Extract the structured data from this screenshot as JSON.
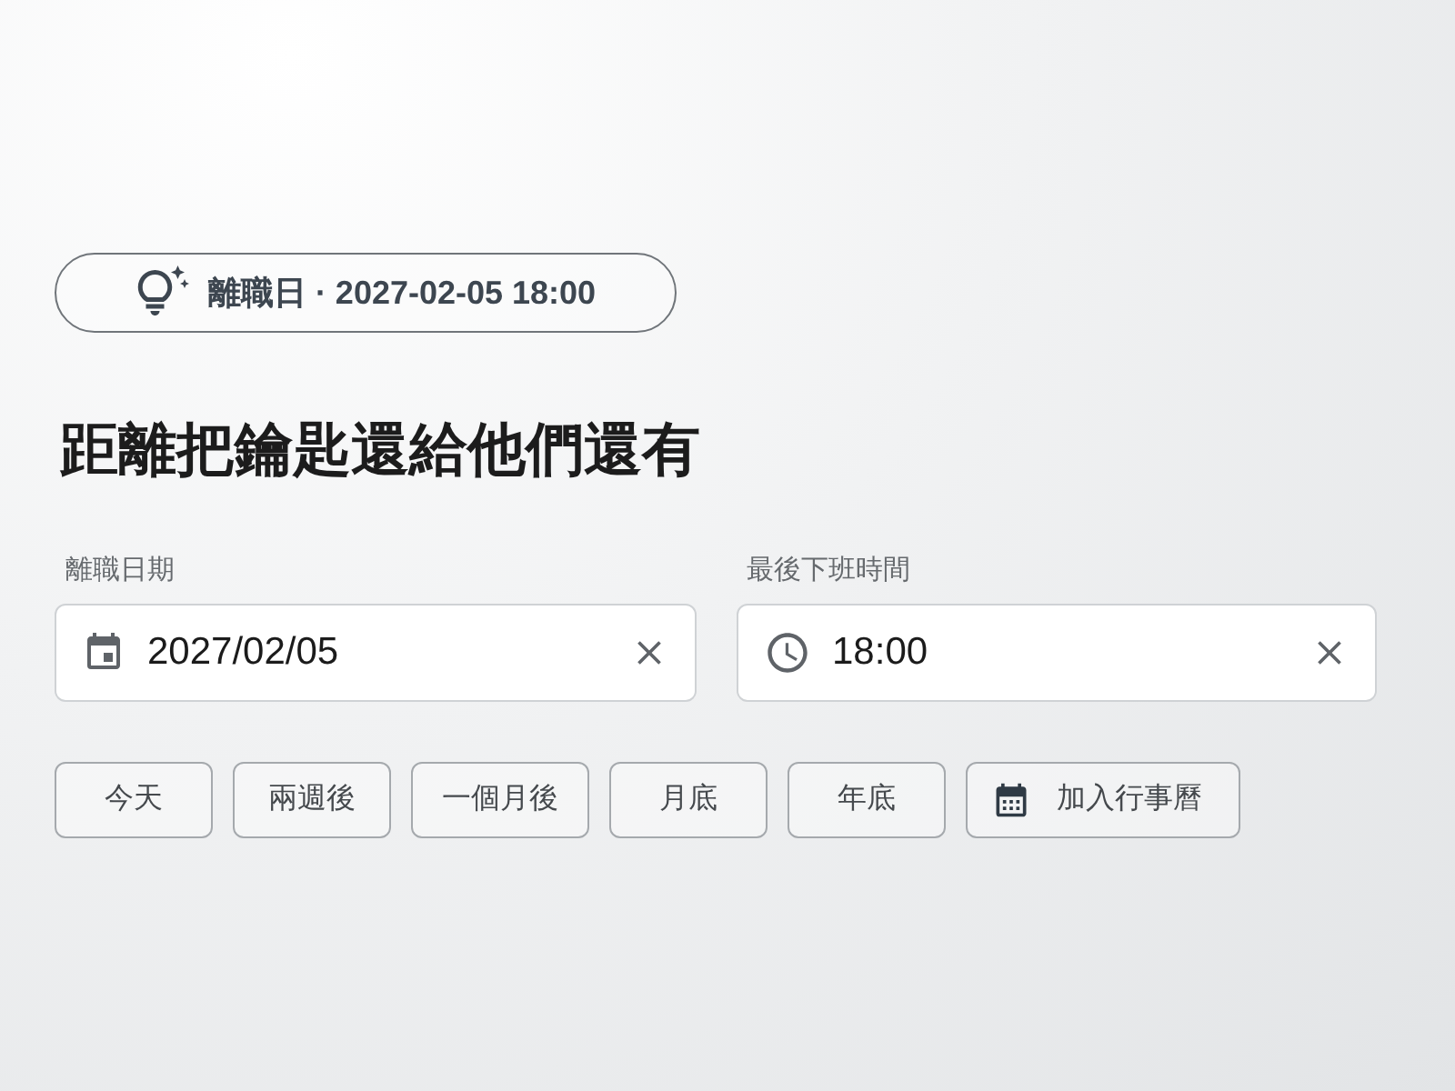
{
  "badge": {
    "text": "離職日 · 2027-02-05 18:00"
  },
  "heading": "距離把鑰匙還給他們還有",
  "fields": [
    {
      "kind": "date",
      "label": "離職日期",
      "value": "2027/02/05"
    },
    {
      "kind": "time",
      "label": "最後下班時間",
      "value": "18:00"
    }
  ],
  "quick_buttons": [
    {
      "kind": "plain",
      "label": "今天"
    },
    {
      "kind": "plain",
      "label": "兩週後"
    },
    {
      "kind": "plain",
      "label": "一個月後"
    },
    {
      "kind": "plain",
      "label": "月底"
    },
    {
      "kind": "plain",
      "label": "年底"
    },
    {
      "kind": "calendar",
      "label": "加入行事曆"
    }
  ]
}
